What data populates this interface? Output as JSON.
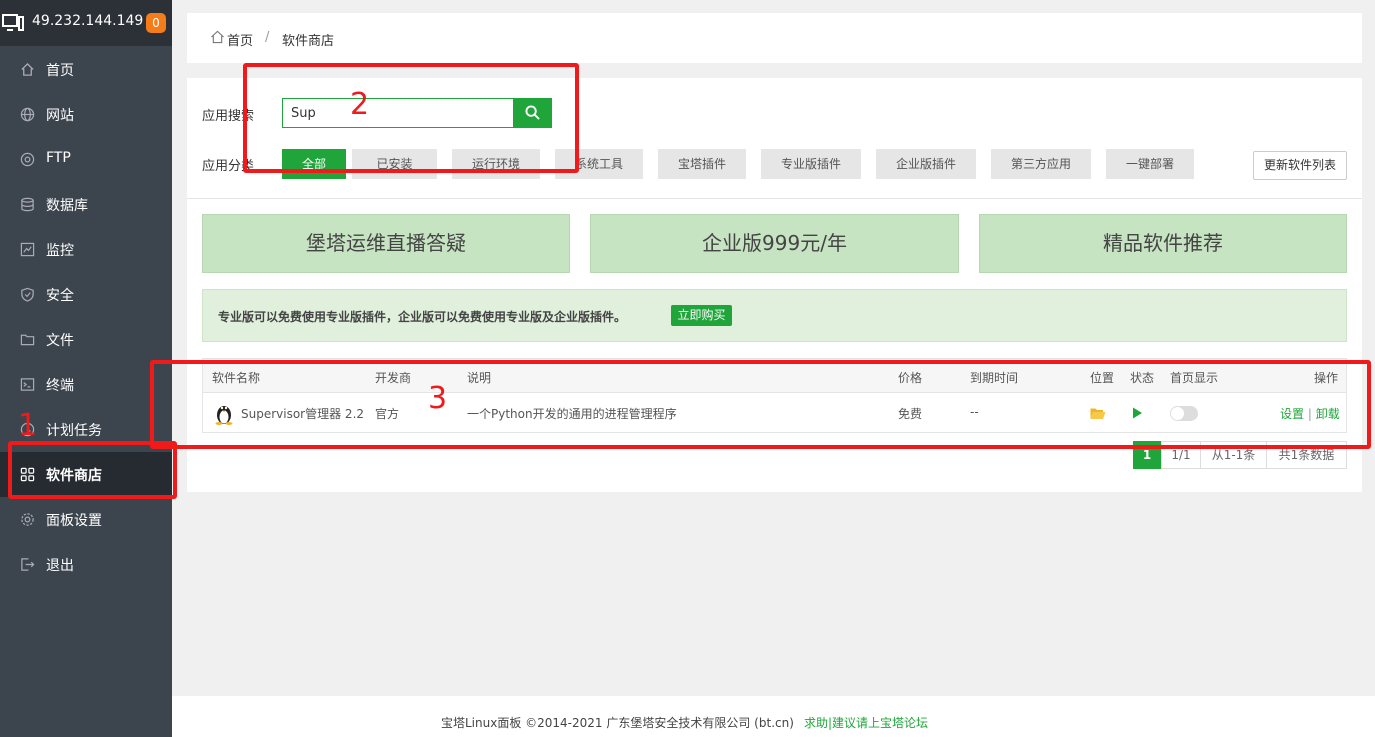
{
  "sidebar": {
    "ip": "49.232.144.149",
    "badge": "0",
    "items": [
      {
        "label": "首页",
        "icon": "home-icon"
      },
      {
        "label": "网站",
        "icon": "globe-icon"
      },
      {
        "label": "FTP",
        "icon": "ftp-icon"
      },
      {
        "label": "数据库",
        "icon": "database-icon"
      },
      {
        "label": "监控",
        "icon": "monitor-chart-icon"
      },
      {
        "label": "安全",
        "icon": "shield-icon"
      },
      {
        "label": "文件",
        "icon": "folder-icon"
      },
      {
        "label": "终端",
        "icon": "terminal-icon"
      },
      {
        "label": "计划任务",
        "icon": "clock-icon"
      },
      {
        "label": "软件商店",
        "icon": "grid-icon",
        "active": true
      },
      {
        "label": "面板设置",
        "icon": "gear-icon"
      },
      {
        "label": "退出",
        "icon": "logout-icon"
      }
    ]
  },
  "breadcrumb": {
    "home": "首页",
    "sep": "/",
    "current": "软件商店"
  },
  "search": {
    "label": "应用搜索",
    "value": "Sup"
  },
  "categories": {
    "label": "应用分类",
    "items": [
      "全部",
      "已安装",
      "运行环境",
      "系统工具",
      "宝塔插件",
      "专业版插件",
      "企业版插件",
      "第三方应用",
      "一键部署"
    ],
    "refresh": "更新软件列表"
  },
  "banners": [
    "堡塔运维直播答疑",
    "企业版999元/年",
    "精品软件推荐"
  ],
  "notice": {
    "text": "专业版可以免费使用专业版插件，企业版可以免费使用专业版及企业版插件。",
    "button": "立即购买"
  },
  "table": {
    "headers": {
      "name": "软件名称",
      "developer": "开发商",
      "desc": "说明",
      "price": "价格",
      "expire": "到期时间",
      "location": "位置",
      "status": "状态",
      "homepage": "首页显示",
      "ops": "操作"
    },
    "row": {
      "name": "Supervisor管理器 2.2",
      "developer": "官方",
      "desc": "一个Python开发的通用的进程管理程序",
      "price": "免费",
      "expire": "--",
      "settings": "设置",
      "ops_sep": "|",
      "uninstall": "卸载"
    }
  },
  "pagination": {
    "current": "1",
    "pages": "1/1",
    "range": "从1-1条",
    "total": "共1条数据"
  },
  "footer": {
    "copyright": "宝塔Linux面板 ©2014-2021 广东堡塔安全技术有限公司 (bt.cn)",
    "link": "求助|建议请上宝塔论坛"
  },
  "annotations": [
    "1",
    "2",
    "3"
  ],
  "colors": {
    "accent": "#20a53a",
    "annotation": "#f01a1a",
    "badge": "#f47c1a"
  }
}
